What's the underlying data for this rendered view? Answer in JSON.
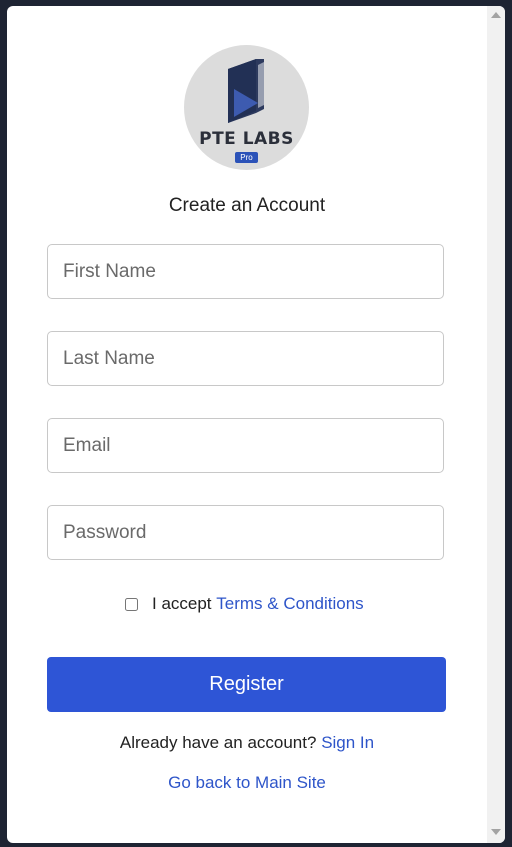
{
  "logo": {
    "brand": "PTE LABS",
    "badge": "Pro"
  },
  "title": "Create an Account",
  "fields": {
    "first_name": {
      "placeholder": "First Name",
      "value": ""
    },
    "last_name": {
      "placeholder": "Last Name",
      "value": ""
    },
    "email": {
      "placeholder": "Email",
      "value": ""
    },
    "password": {
      "placeholder": "Password",
      "value": ""
    }
  },
  "terms": {
    "prefix": "I accept",
    "link": "Terms & Conditions",
    "checked": false
  },
  "register_label": "Register",
  "signin": {
    "prompt": "Already have an account?",
    "link": "Sign In"
  },
  "back_link": "Go back to Main Site",
  "colors": {
    "accent": "#2e55d6",
    "link": "#2e55c9",
    "logo_bg": "#dcdcdc",
    "outer_bg": "#1e2433"
  }
}
